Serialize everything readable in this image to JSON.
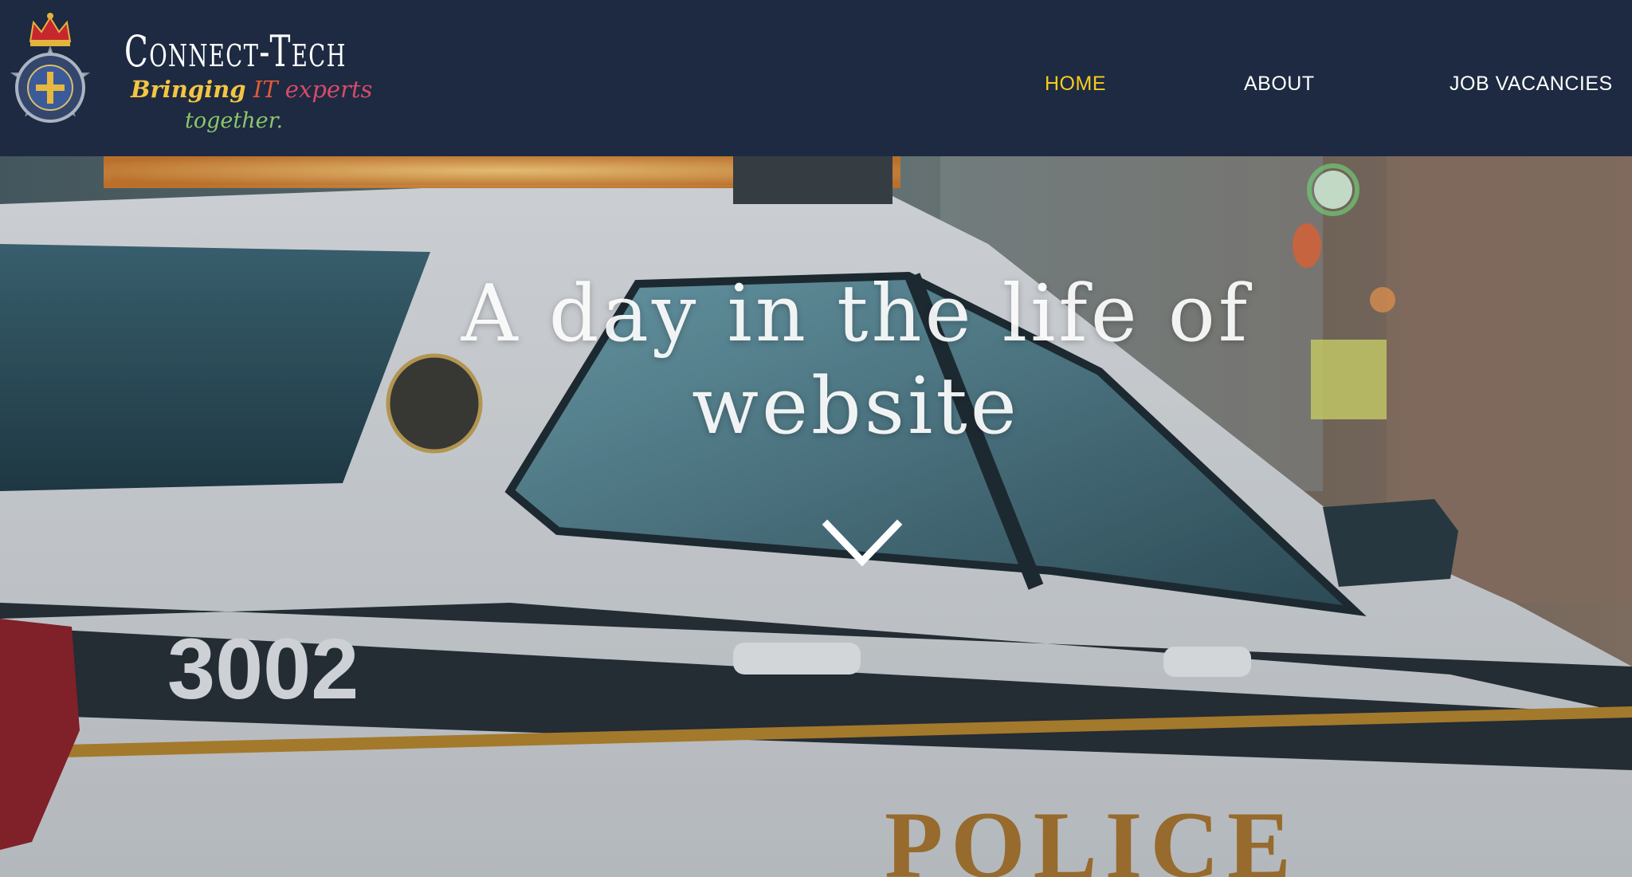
{
  "header": {
    "logo": {
      "crest_icon": "police-crest-icon",
      "brand_name": "Connect-Tech",
      "tagline_words": [
        "Bringing",
        "IT",
        "experts"
      ],
      "tagline_line2": "together."
    },
    "nav": {
      "items": [
        {
          "label": "HOME",
          "active": true
        },
        {
          "label": "ABOUT",
          "active": false
        },
        {
          "label": "JOB VACANCIES",
          "active": false
        }
      ]
    }
  },
  "hero": {
    "title": "A day in the life of website",
    "scroll_icon": "chevron-down-icon"
  },
  "colors": {
    "header_bg": "#1d2a41",
    "nav_active": "#f7cc1e",
    "nav_text": "#ffffff"
  }
}
